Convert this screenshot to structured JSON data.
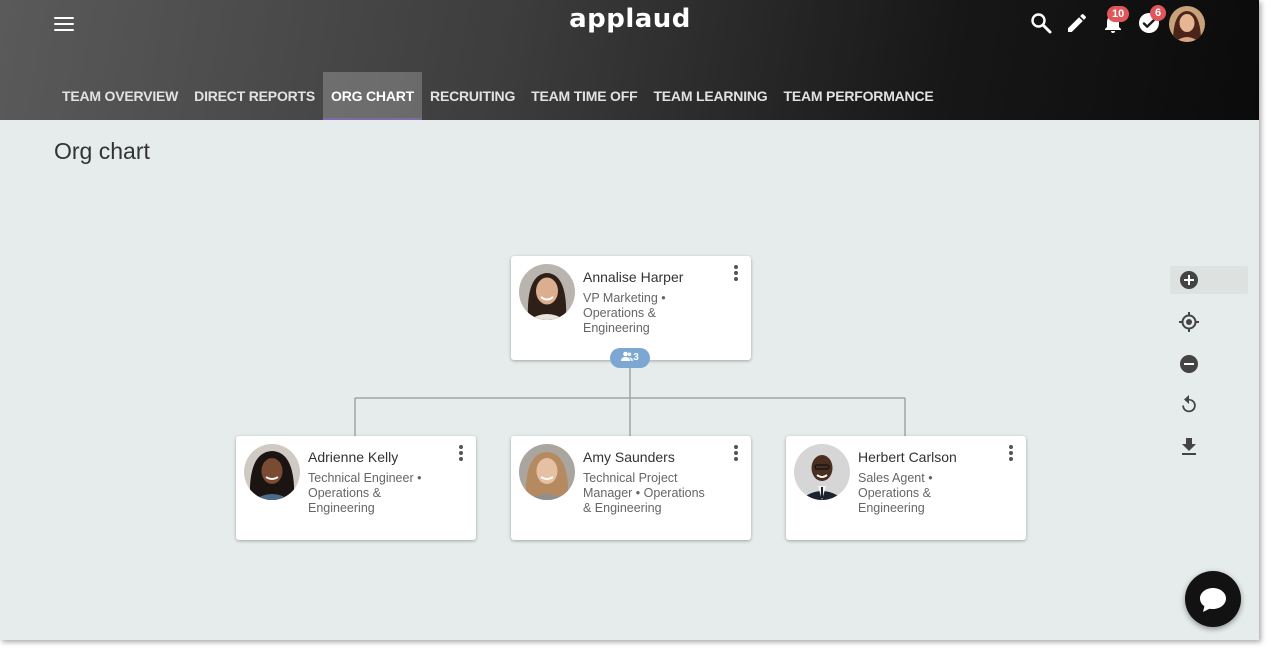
{
  "header": {
    "logo_text": "applaud",
    "notifications_count": "10",
    "tasks_count": "6"
  },
  "tabs": [
    {
      "label": "TEAM OVERVIEW",
      "active": false
    },
    {
      "label": "DIRECT REPORTS",
      "active": false
    },
    {
      "label": "ORG CHART",
      "active": true
    },
    {
      "label": "RECRUITING",
      "active": false
    },
    {
      "label": "TEAM TIME OFF",
      "active": false
    },
    {
      "label": "TEAM LEARNING",
      "active": false
    },
    {
      "label": "TEAM PERFORMANCE",
      "active": false
    }
  ],
  "page": {
    "title": "Org chart"
  },
  "org": {
    "root": {
      "name": "Annalise Harper",
      "role": "VP Marketing • Operations & Engineering",
      "reports_count": "3"
    },
    "reports": [
      {
        "name": "Adrienne Kelly",
        "role": "Technical Engineer • Operations & Engineering"
      },
      {
        "name": "Amy Saunders",
        "role": "Technical Project Manager • Operations & Engineering"
      },
      {
        "name": "Herbert Carlson",
        "role": "Sales Agent • Operations & Engineering"
      }
    ]
  },
  "tools": [
    "zoom-in-icon",
    "recenter-icon",
    "zoom-out-icon",
    "reset-icon",
    "download-icon"
  ],
  "colors": {
    "page_bg": "#e5eceb",
    "badge_red": "#e0575b",
    "reports_badge_blue": "#7da7d3",
    "active_tab_underline": "#7f6aa5"
  }
}
